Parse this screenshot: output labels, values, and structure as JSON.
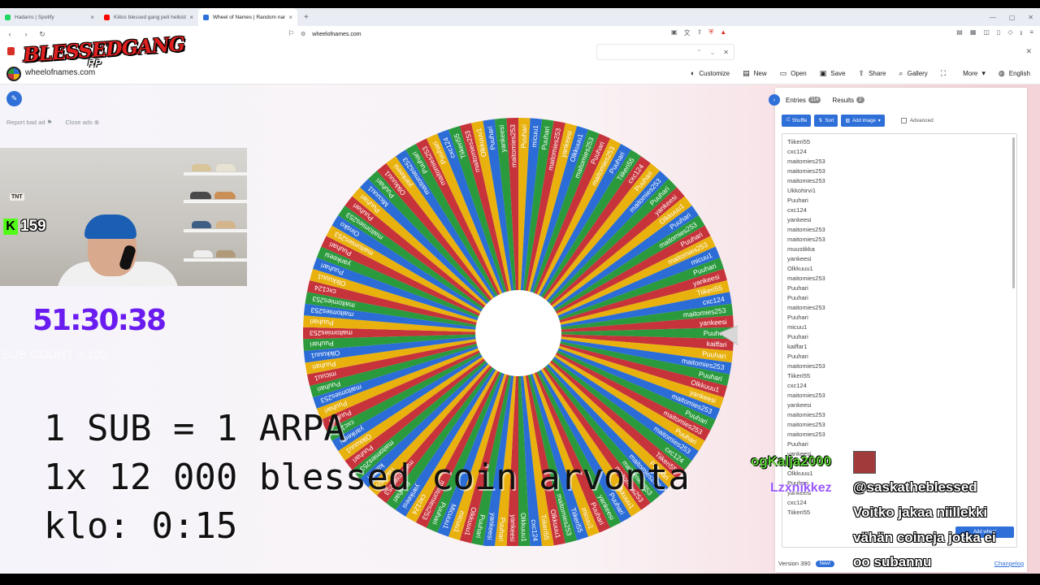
{
  "browser": {
    "tabs": [
      {
        "title": "Hadarro | Spotify",
        "color": "#1ed760",
        "active": false
      },
      {
        "title": "Kiitos blessed gang peli hetkist - Yo",
        "color": "#ff0000",
        "active": false
      },
      {
        "title": "Wheel of Names | Random name",
        "color": "#2f6fd8",
        "active": true
      }
    ],
    "url": "wheelofnames.com"
  },
  "site": {
    "name": "wheelofnames.com",
    "nav": [
      {
        "icon": "palette-icon",
        "glyph": "◐",
        "label": "Customize"
      },
      {
        "icon": "new-file-icon",
        "glyph": "▤",
        "label": "New"
      },
      {
        "icon": "open-folder-icon",
        "glyph": "▭",
        "label": "Open"
      },
      {
        "icon": "save-icon",
        "glyph": "▣",
        "label": "Save"
      },
      {
        "icon": "share-icon",
        "glyph": "⇪",
        "label": "Share"
      },
      {
        "icon": "search-icon",
        "glyph": "⌕",
        "label": "Gallery"
      },
      {
        "icon": "fullscreen-icon",
        "glyph": "⛶",
        "label": ""
      },
      {
        "icon": "caret-down-icon",
        "glyph": "▾",
        "label": "More"
      },
      {
        "icon": "globe-icon",
        "glyph": "◍",
        "label": "English"
      }
    ]
  },
  "ads": {
    "report": "Report bad ad",
    "close": "Close ads"
  },
  "sidebar": {
    "entries_tab": "Entries",
    "entries_count": "114",
    "results_tab": "Results",
    "results_count": "2",
    "shuffle": "Shuffle",
    "sort": "Sort",
    "add_image": "Add image",
    "advanced": "Advanced",
    "version": "Version 390",
    "new_badge": "New!",
    "changelog": "Changelog",
    "entries": [
      "Tiikeri55",
      "cxc124",
      "maitomies253",
      "maitomies253",
      "maitomies253",
      "Ukkohirvi1",
      "Puuhari",
      "cxc124",
      "yankeesi",
      "maitomies253",
      "maitomies253",
      "muustikka",
      "yankeesi",
      "Olkkuuu1",
      "maitomies253",
      "Puuhari",
      "Puuhari",
      "maitomies253",
      "Puuhari",
      "micuu1",
      "Puuhari",
      "kaiffar1",
      "Puuhari",
      "maitomies253",
      "Tiikeri55",
      "cxc124",
      "maitomies253",
      "yankeesi",
      "maitomies253",
      "maitomies253",
      "maitomies253",
      "Puuhari",
      "yankeesi",
      "Puuhari",
      "Olkkuuu1",
      "Puuhari",
      "yankeesi",
      "cxc124",
      "Tiikeri55"
    ]
  },
  "wheel": {
    "colors": [
      "#2a9a3d",
      "#c7333b",
      "#e8b10e",
      "#2b6cd6"
    ],
    "names": [
      "Puuhari",
      "kaiffari",
      "Puuhari",
      "maitomies253",
      "Puuhari",
      "Olkkuuu1",
      "yankeesi",
      "maitomies253",
      "Puuhari",
      "maitomies253",
      "Puuhari",
      "maitomies253",
      "cxc124",
      "Tiikeri55",
      "Puuhari",
      "maitomies253",
      "maitomies253",
      "maitomies253",
      "Olkkuuu1",
      "Puuhari",
      "yankeesi",
      "Puuhari",
      "micuu1",
      "Tiikeri55",
      "maitomies253",
      "Olkkuuu1",
      "Tiikeri55",
      "cxc124",
      "Olkkuuu1",
      "yankeesi",
      "Puuhari",
      "yankeesi",
      "Puuhari",
      "Olkkuuu1",
      "micuu1",
      "Micuuu1",
      "Puuhari",
      "maitomies253",
      "cxc124",
      "yankeesi",
      "Puuhari",
      "maitomies253",
      "Tiikeri55",
      "kaiffari",
      "maitomies253",
      "Puuhari",
      "Olkkuuu1",
      "yankeesi",
      "cxc124",
      "Puuhari",
      "Puuhari",
      "maitomies253",
      "Puuhari",
      "micuu1",
      "Puuhari",
      "Olkkuuu1",
      "Puuhari",
      "maitomies253",
      "Puuhari",
      "maitomies253",
      "maitomies253",
      "cxc124",
      "Olkkuuu1",
      "Puuhari",
      "yankeesi",
      "Puuhari",
      "maitomies253",
      "Oinsko",
      "maitomies253",
      "Puuhari",
      "Puuhari",
      "Micuuu1",
      "Puuhari",
      "Olkkuuu1",
      "yankeesi",
      "maitomies253",
      "Puuhari",
      "maitomies253",
      "Puuhari",
      "cxc124",
      "Tiikeri55",
      "maitomies253",
      "Olkkuuu1",
      "Puuhari",
      "yankeesi",
      "maitomies253",
      "Puuhari",
      "micuu1",
      "Puuhari",
      "maitomies253",
      "yankeesi",
      "Olkkuuu1",
      "maitomies253",
      "Puuhari",
      "maitomies253",
      "Puuhari",
      "Tiikeri55",
      "cxc124",
      "Puuhari",
      "maitomies253",
      "Puuhari",
      "yankeesi",
      "Olkkuuu1",
      "Puuhari",
      "maitomies253",
      "Puuhari",
      "maitomies253",
      "micuu1",
      "Puuhari",
      "yankeesi",
      "Tiikeri55",
      "cxc124",
      "maitomies253",
      "yankeesi"
    ]
  },
  "stream": {
    "brand": "BLESSEDGANG",
    "brand_sub": "RP",
    "kick_count": "159",
    "timer": "51:30:38",
    "sub_count": "SUB COUNT = 109",
    "line1": "1 SUB = 1 ARPA",
    "line2": "1x 12 000 blessed coin arvonta",
    "line3": "klo: 0:15",
    "chat": {
      "user1": "ogKalja2000",
      "user2": "Lzxnikkez",
      "message_lines": [
        "@saskatheblessed",
        "Voitko jakaa niillekki",
        "vähän coineja jotka ei",
        "oo subannu"
      ]
    },
    "add_wheel": "Add wheel"
  }
}
